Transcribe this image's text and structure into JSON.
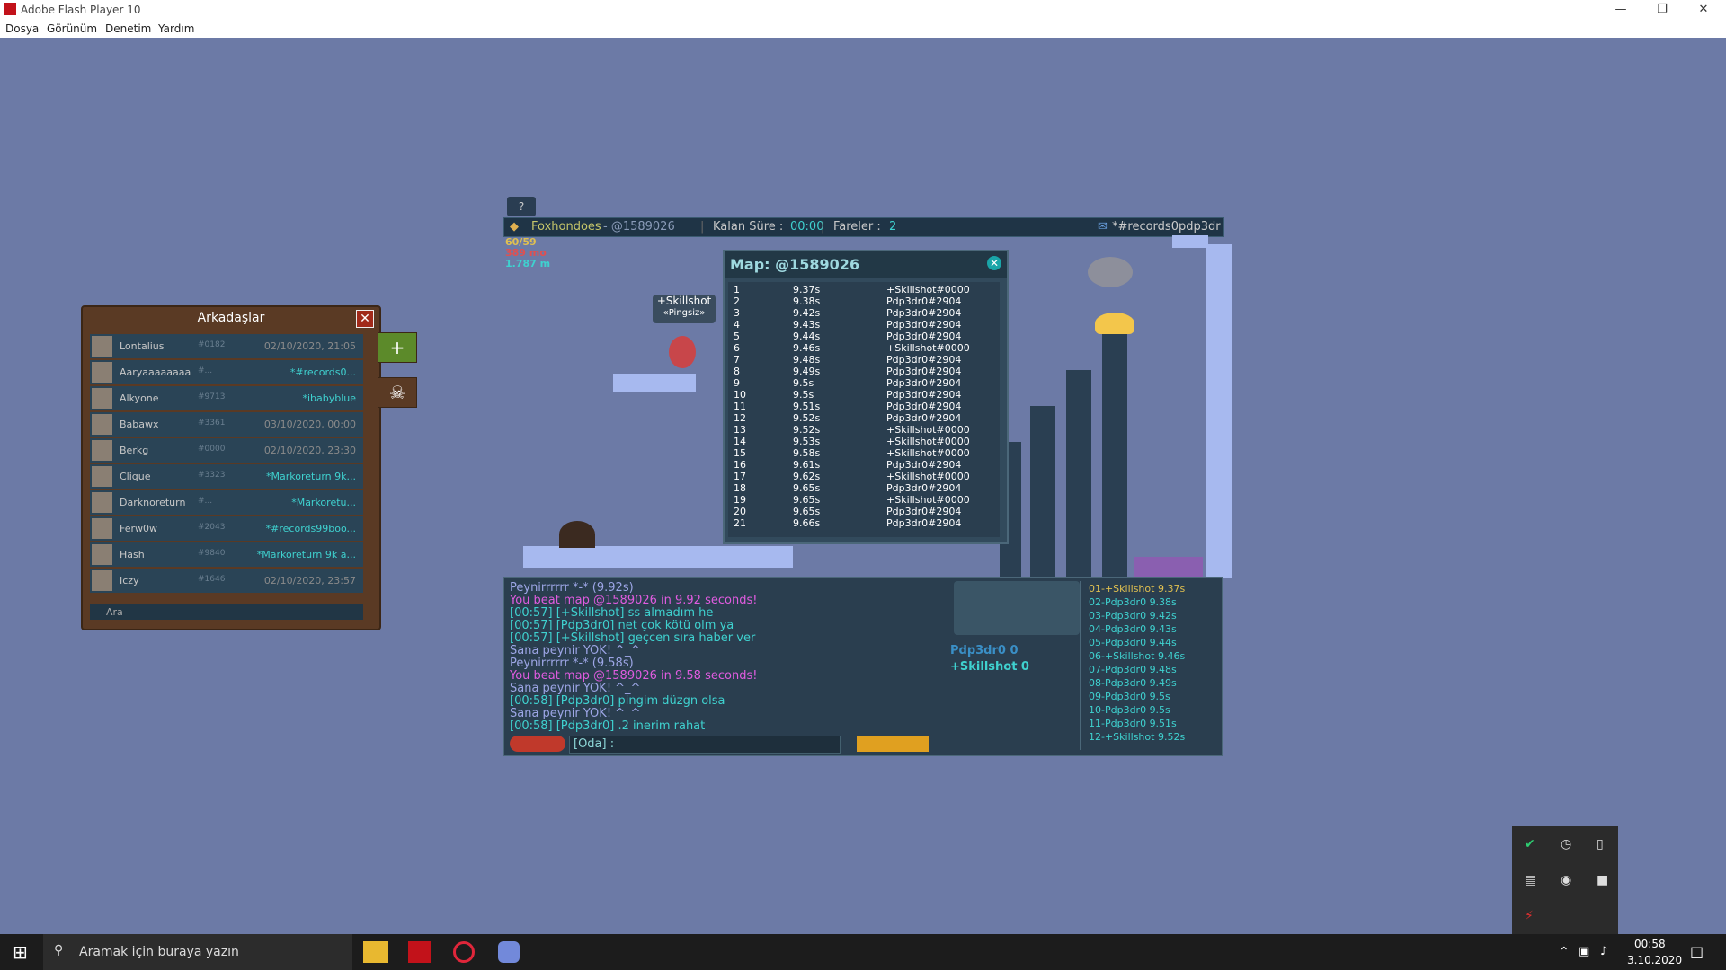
{
  "window": {
    "title": "Adobe Flash Player 10",
    "minimize": "—",
    "restore": "❐",
    "close": "✕"
  },
  "menu": [
    "Dosya",
    "Görünüm",
    "Denetim",
    "Yardım"
  ],
  "game": {
    "help": "?",
    "room_player": "Foxhondoes",
    "room_map": " - @1589026",
    "time_label": "Kalan Süre :",
    "time_value": "00:00",
    "mice_label": "Fareler :",
    "mice_value": "2",
    "room_name": "*#records0pdp3dr",
    "stat1": "60/59",
    "stat2": "389 mo",
    "stat3": "1.787 m",
    "player_tag": "+Skillshot",
    "player_sub": "«Pingsiz»"
  },
  "map_panel": {
    "title": "Map: @1589026",
    "close": "✕",
    "records": [
      [
        "1",
        "9.37s",
        "+Skillshot#0000"
      ],
      [
        "2",
        "9.38s",
        "Pdp3dr0#2904"
      ],
      [
        "3",
        "9.42s",
        "Pdp3dr0#2904"
      ],
      [
        "4",
        "9.43s",
        "Pdp3dr0#2904"
      ],
      [
        "5",
        "9.44s",
        "Pdp3dr0#2904"
      ],
      [
        "6",
        "9.46s",
        "+Skillshot#0000"
      ],
      [
        "7",
        "9.48s",
        "Pdp3dr0#2904"
      ],
      [
        "8",
        "9.49s",
        "Pdp3dr0#2904"
      ],
      [
        "9",
        "9.5s",
        "Pdp3dr0#2904"
      ],
      [
        "10",
        "9.5s",
        "Pdp3dr0#2904"
      ],
      [
        "11",
        "9.51s",
        "Pdp3dr0#2904"
      ],
      [
        "12",
        "9.52s",
        "Pdp3dr0#2904"
      ],
      [
        "13",
        "9.52s",
        "+Skillshot#0000"
      ],
      [
        "14",
        "9.53s",
        "+Skillshot#0000"
      ],
      [
        "15",
        "9.58s",
        "+Skillshot#0000"
      ],
      [
        "16",
        "9.61s",
        "Pdp3dr0#2904"
      ],
      [
        "17",
        "9.62s",
        "+Skillshot#0000"
      ],
      [
        "18",
        "9.65s",
        "Pdp3dr0#2904"
      ],
      [
        "19",
        "9.65s",
        "+Skillshot#0000"
      ],
      [
        "20",
        "9.65s",
        "Pdp3dr0#2904"
      ],
      [
        "21",
        "9.66s",
        "Pdp3dr0#2904"
      ]
    ]
  },
  "chat": {
    "lines": [
      {
        "text": "Peynirrrrrr *-* (9.92s)",
        "color": "#9da6e6"
      },
      {
        "text": "You beat map @1589026 in 9.92 seconds!",
        "color": "#e05ce0"
      },
      {
        "text": "[00:57] [+Skillshot] ss almadım he",
        "color": "#3fd1cf"
      },
      {
        "text": "[00:57] [Pdp3dr0] net çok kötü olm ya",
        "color": "#3fd1cf"
      },
      {
        "text": "[00:57] [+Skillshot] geçcen sıra haber ver",
        "color": "#3fd1cf"
      },
      {
        "text": "Sana peynir YOK! ^_^",
        "color": "#9da6e6"
      },
      {
        "text": "Peynirrrrrr *-* (9.58s)",
        "color": "#9da6e6"
      },
      {
        "text": "You beat map @1589026 in 9.58 seconds!",
        "color": "#e05ce0"
      },
      {
        "text": "Sana peynir YOK! ^_^",
        "color": "#9da6e6"
      },
      {
        "text": "[00:58] [Pdp3dr0] pingim düzgn olsa",
        "color": "#3fd1cf"
      },
      {
        "text": "Sana peynir YOK! ^_^",
        "color": "#9da6e6"
      },
      {
        "text": "[00:58] [Pdp3dr0] .2 inerim rahat",
        "color": "#3fd1cf"
      }
    ],
    "input_label": "[Oda] :",
    "score1": "Pdp3dr0 0",
    "score2": "+Skillshot 0",
    "ranking": [
      "01-+Skillshot 9.37s",
      "02-Pdp3dr0 9.38s",
      "03-Pdp3dr0 9.42s",
      "04-Pdp3dr0 9.43s",
      "05-Pdp3dr0 9.44s",
      "06-+Skillshot 9.46s",
      "07-Pdp3dr0 9.48s",
      "08-Pdp3dr0 9.49s",
      "09-Pdp3dr0 9.5s",
      "10-Pdp3dr0 9.5s",
      "11-Pdp3dr0 9.51s",
      "12-+Skillshot 9.52s"
    ]
  },
  "friends": {
    "title": "Arkadaşlar",
    "close": "✕",
    "search": "Ara",
    "list": [
      {
        "name": "Lontalius",
        "tag": "#0182",
        "right": "02/10/2020, 21:05"
      },
      {
        "name": "Aaryaaaaaaaa",
        "tag": "#...",
        "right": "*#records0..."
      },
      {
        "name": "Alkyone",
        "tag": "#9713",
        "right": "*ibabyblue"
      },
      {
        "name": "Babawx",
        "tag": "#3361",
        "right": "03/10/2020, 00:00"
      },
      {
        "name": "Berkg",
        "tag": "#0000",
        "right": "02/10/2020, 23:30"
      },
      {
        "name": "Clique",
        "tag": "#3323",
        "right": "*Markoreturn 9k..."
      },
      {
        "name": "Darknoreturn",
        "tag": "#...",
        "right": "*Markoretu..."
      },
      {
        "name": "Ferw0w",
        "tag": "#2043",
        "right": "*#records99boo..."
      },
      {
        "name": "Hash",
        "tag": "#9840",
        "right": "*Markoreturn 9k a..."
      },
      {
        "name": "Iczy",
        "tag": "#1646",
        "right": "02/10/2020, 23:57"
      }
    ]
  },
  "taskbar": {
    "start": "⊞",
    "search_placeholder": "Aramak için buraya yazın",
    "time": "00:58",
    "date": "3.10.2020"
  }
}
